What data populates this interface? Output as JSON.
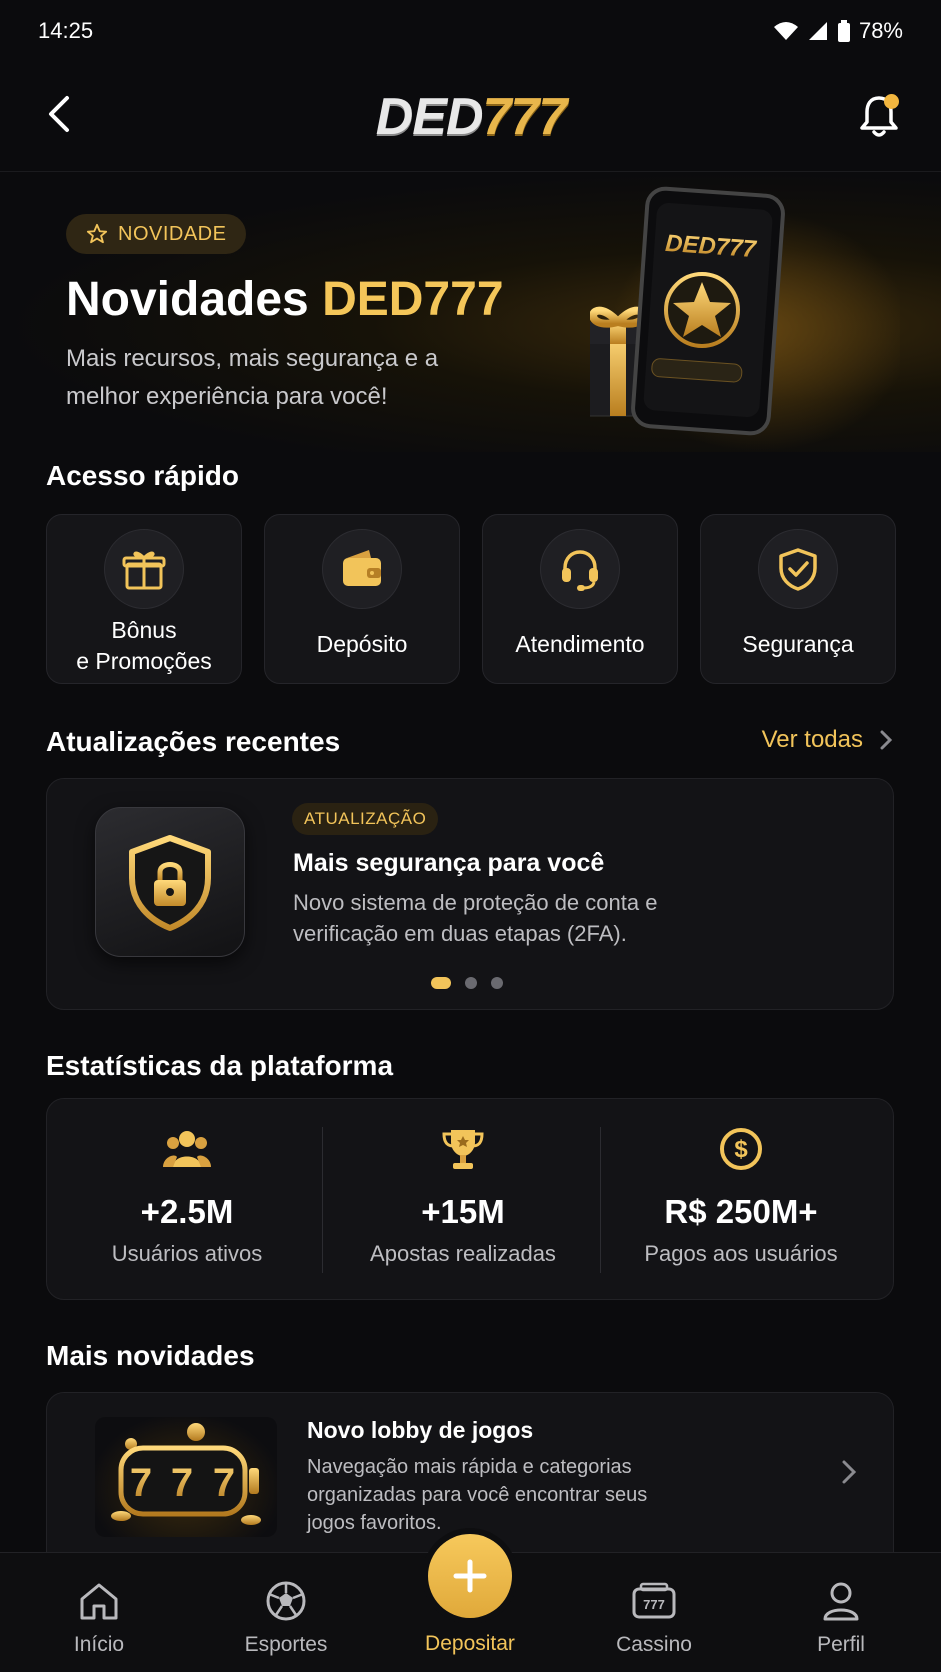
{
  "status_bar": {
    "time": "14:25",
    "battery": "78%"
  },
  "header": {
    "logo_part1": "DED",
    "logo_part2": "777"
  },
  "hero": {
    "badge": "NOVIDADE",
    "title_part1": "Novidades ",
    "title_part2": "DED777",
    "subtitle": "Mais recursos, mais segurança e a melhor experiência para você!",
    "phone_screen_logo": "DED777"
  },
  "quick_access": {
    "title": "Acesso rápido",
    "items": [
      {
        "label": "Bônus\ne Promoções",
        "icon": "gift-icon"
      },
      {
        "label": "Depósito",
        "icon": "wallet-icon"
      },
      {
        "label": "Atendimento",
        "icon": "headset-icon"
      },
      {
        "label": "Segurança",
        "icon": "shield-check-icon"
      }
    ]
  },
  "recent_updates": {
    "title": "Atualizações recentes",
    "see_all": "Ver todas",
    "card": {
      "badge": "ATUALIZAÇÃO",
      "title": "Mais segurança para você",
      "description": "Novo sistema de proteção de conta e verificação em duas etapas (2FA).",
      "page_count": 3,
      "active_page": 1
    }
  },
  "stats": {
    "title": "Estatísticas da plataforma",
    "items": [
      {
        "value": "+2.5M",
        "caption": "Usuários ativos",
        "icon": "users-icon"
      },
      {
        "value": "+15M",
        "caption": "Apostas realizadas",
        "icon": "trophy-icon"
      },
      {
        "value": "R$ 250M+",
        "caption": "Pagos aos usuários",
        "icon": "dollar-coin-icon"
      }
    ]
  },
  "more_news": {
    "title": "Mais novidades",
    "item": {
      "title": "Novo lobby de jogos",
      "description": "Navegação mais rápida e categorias organizadas para você encontrar seus jogos favoritos.",
      "image_text": "777"
    }
  },
  "bottom_nav": {
    "items": [
      {
        "label": "Início",
        "icon": "home-icon"
      },
      {
        "label": "Esportes",
        "icon": "soccer-ball-icon"
      },
      {
        "label": "Depositar",
        "icon": "plus-icon",
        "active": true
      },
      {
        "label": "Cassino",
        "icon": "slot-machine-icon"
      },
      {
        "label": "Perfil",
        "icon": "user-icon"
      }
    ]
  },
  "colors": {
    "accent": "#f2c45a",
    "background": "#0b0b0d",
    "card": "#131316"
  }
}
